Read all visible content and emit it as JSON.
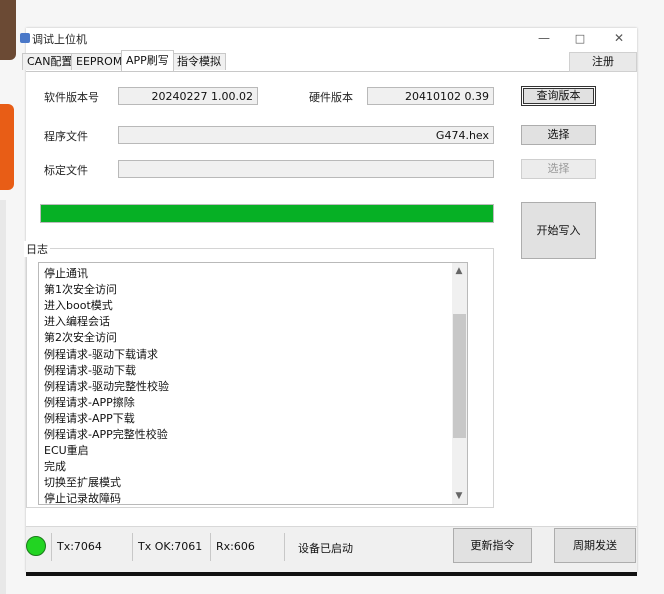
{
  "window": {
    "title": "调试上位机",
    "minimize_glyph": "—",
    "maximize_glyph": "□",
    "close_glyph": "✕"
  },
  "tabs": [
    {
      "label": "CAN配置"
    },
    {
      "label": "EEPROM"
    },
    {
      "label": "APP刷写",
      "active": true
    },
    {
      "label": "指令模拟"
    }
  ],
  "register_label": "注册",
  "version": {
    "software_label": "软件版本号",
    "software_value": "20240227 1.00.02",
    "hardware_label": "硬件版本",
    "hardware_value": "20410102 0.39",
    "query_button": "查询版本"
  },
  "program_file": {
    "label": "程序文件",
    "value": "G474.hex",
    "button": "选择"
  },
  "calibration_file": {
    "label": "标定文件",
    "value": "",
    "button": "选择"
  },
  "progress": {
    "percent": 100,
    "color": "#06b025"
  },
  "start_write_button": "开始写入",
  "log": {
    "label": "日志",
    "lines": [
      "停止通讯",
      "第1次安全访问",
      "进入boot模式",
      "进入编程会话",
      "第2次安全访问",
      "例程请求-驱动下载请求",
      "例程请求-驱动下载",
      "例程请求-驱动完整性校验",
      "例程请求-APP擦除",
      "例程请求-APP下载",
      "例程请求-APP完整性校验",
      "ECU重启",
      "完成",
      "切换至扩展模式",
      "停止记录故障码"
    ],
    "scroll_up": "▲",
    "scroll_down": "▼"
  },
  "status": {
    "led_color": "#22d422",
    "tx": "Tx:7064",
    "tx_ok": "Tx OK:7061",
    "rx": "Rx:606",
    "device": "设备已启动",
    "update_button": "更新指令",
    "periodic_button": "周期发送"
  }
}
